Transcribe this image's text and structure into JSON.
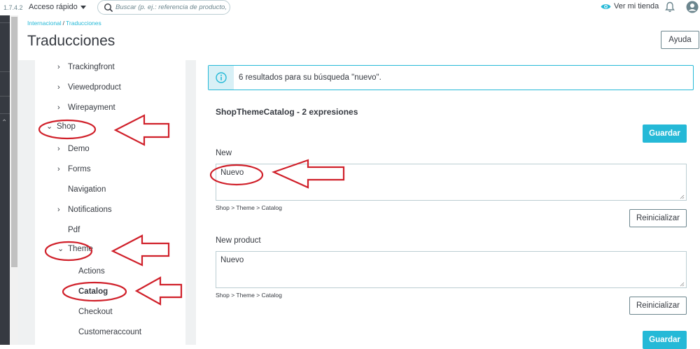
{
  "topbar": {
    "version": "1.7.4.2",
    "quick_access": "Acceso rápido",
    "search_placeholder": "Buscar (p. ej.: referencia de producto, no",
    "view_shop": "Ver mi tienda"
  },
  "breadcrumb": {
    "parent": "Internacional",
    "separator": "/",
    "current": "Traducciones"
  },
  "page": {
    "title": "Traducciones",
    "help": "Ayuda"
  },
  "tree": {
    "items": [
      {
        "label": "Trackingfront",
        "chevron": "›"
      },
      {
        "label": "Viewedproduct",
        "chevron": "›"
      },
      {
        "label": "Wirepayment",
        "chevron": "›"
      },
      {
        "label": "Shop",
        "chevron": "⌄"
      },
      {
        "label": "Demo",
        "chevron": "›"
      },
      {
        "label": "Forms",
        "chevron": "›"
      },
      {
        "label": "Navigation",
        "chevron": ""
      },
      {
        "label": "Notifications",
        "chevron": "›"
      },
      {
        "label": "Pdf",
        "chevron": ""
      },
      {
        "label": "Theme",
        "chevron": "⌄"
      },
      {
        "label": "Actions",
        "chevron": ""
      },
      {
        "label": "Catalog",
        "chevron": ""
      },
      {
        "label": "Checkout",
        "chevron": ""
      },
      {
        "label": "Customeraccount",
        "chevron": ""
      }
    ]
  },
  "main": {
    "alert": "6 resultados para su búsqueda \"nuevo\".",
    "section_title": "ShopThemeCatalog - 2 expresiones",
    "save_label": "Guardar",
    "reset_label": "Reinicializar",
    "entries": [
      {
        "label": "New",
        "value": "Nuevo",
        "path": "Shop > Theme > Catalog"
      },
      {
        "label": "New product",
        "value": "Nuevo",
        "path": "Shop > Theme > Catalog"
      }
    ]
  },
  "colors": {
    "accent": "#25b9d7",
    "annotation": "#d0202a",
    "sidebar_dark": "#363a41"
  }
}
